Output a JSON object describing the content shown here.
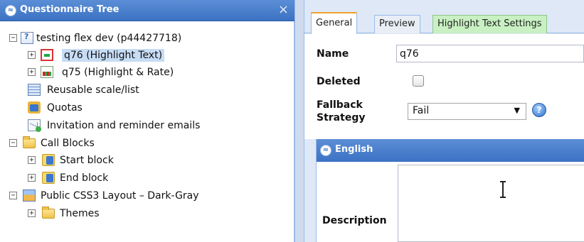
{
  "left_panel": {
    "title": "Questionnaire Tree",
    "close_glyph": "×",
    "collapse_glyph": "≈",
    "tree": [
      {
        "label": "testing flex dev (p44427718)",
        "expander": "−",
        "icon": "questionnaire-icon"
      },
      {
        "label": "q76 (Highlight Text)",
        "expander": "+",
        "icon": "highlight-text-icon",
        "selected": true
      },
      {
        "label": "q75 (Highlight & Rate)",
        "expander": "+",
        "icon": "highlight-rate-icon"
      },
      {
        "label": "Reusable scale/list",
        "expander": "",
        "icon": "scale-list-icon"
      },
      {
        "label": "Quotas",
        "expander": "",
        "icon": "quotas-icon"
      },
      {
        "label": "Invitation and reminder emails",
        "expander": "",
        "icon": "email-icon"
      },
      {
        "label": "Call Blocks",
        "expander": "−",
        "icon": "folder-icon"
      },
      {
        "label": "Start block",
        "expander": "+",
        "icon": "block-icon"
      },
      {
        "label": "End block",
        "expander": "+",
        "icon": "block-icon"
      },
      {
        "label": "Public CSS3 Layout – Dark-Gray",
        "expander": "−",
        "icon": "layout-icon"
      },
      {
        "label": "Themes",
        "expander": "+",
        "icon": "folder-icon"
      }
    ]
  },
  "right_panel": {
    "tabs": [
      {
        "label": "General",
        "active": true
      },
      {
        "label": "Preview",
        "active": false
      },
      {
        "label": "Highlight Text Settings",
        "active": false
      }
    ],
    "form": {
      "name_label": "Name",
      "name_value": "q76",
      "deleted_label": "Deleted",
      "deleted_checked": false,
      "fallback_label_line1": "Fallback",
      "fallback_label_line2": "Strategy",
      "fallback_value": "Fail",
      "select_arrow": "▼",
      "help_glyph": "?"
    },
    "section": {
      "title": "English",
      "collapse_glyph": "≈",
      "description_label": "Description"
    }
  },
  "colors": {
    "header_blue": "#3c72c4",
    "selection": "#c7dcf5",
    "active_tab_accent": "#f0a030",
    "green_tab": "#c8f0c2"
  }
}
